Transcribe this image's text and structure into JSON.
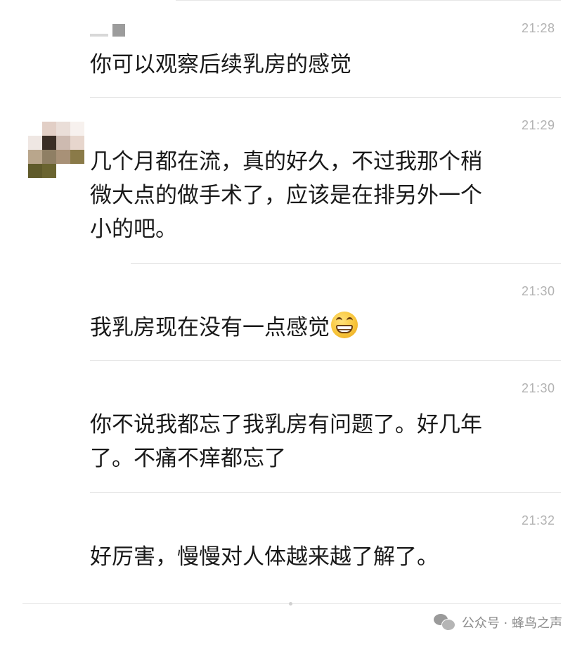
{
  "messages": [
    {
      "time": "21:28",
      "text": [
        "你可以观察后续乳房的感觉"
      ]
    },
    {
      "time": "21:29",
      "text": [
        "几个月都在流，真的好久，不过我那个稍",
        "微大点的做手术了，应该是在排另外一个",
        "小的吧。"
      ]
    },
    {
      "time": "21:30",
      "text": [
        "我乳房现在没有一点感觉"
      ],
      "emoji": "grinning-face-emoji"
    },
    {
      "time": "21:30",
      "text": [
        "你不说我都忘了我乳房有问题了。好几年",
        "了。不痛不痒都忘了"
      ]
    },
    {
      "time": "21:32",
      "text": [
        "好厉害，慢慢对人体越来越了解了。"
      ]
    }
  ],
  "footer": {
    "icon": "wechat-icon",
    "label": "公众号 · 蜂鸟之声"
  },
  "colors": {
    "text": "#191919",
    "time": "#b2b2b2",
    "divider": "#e6e6e6",
    "footer": "#8a8a8a"
  }
}
